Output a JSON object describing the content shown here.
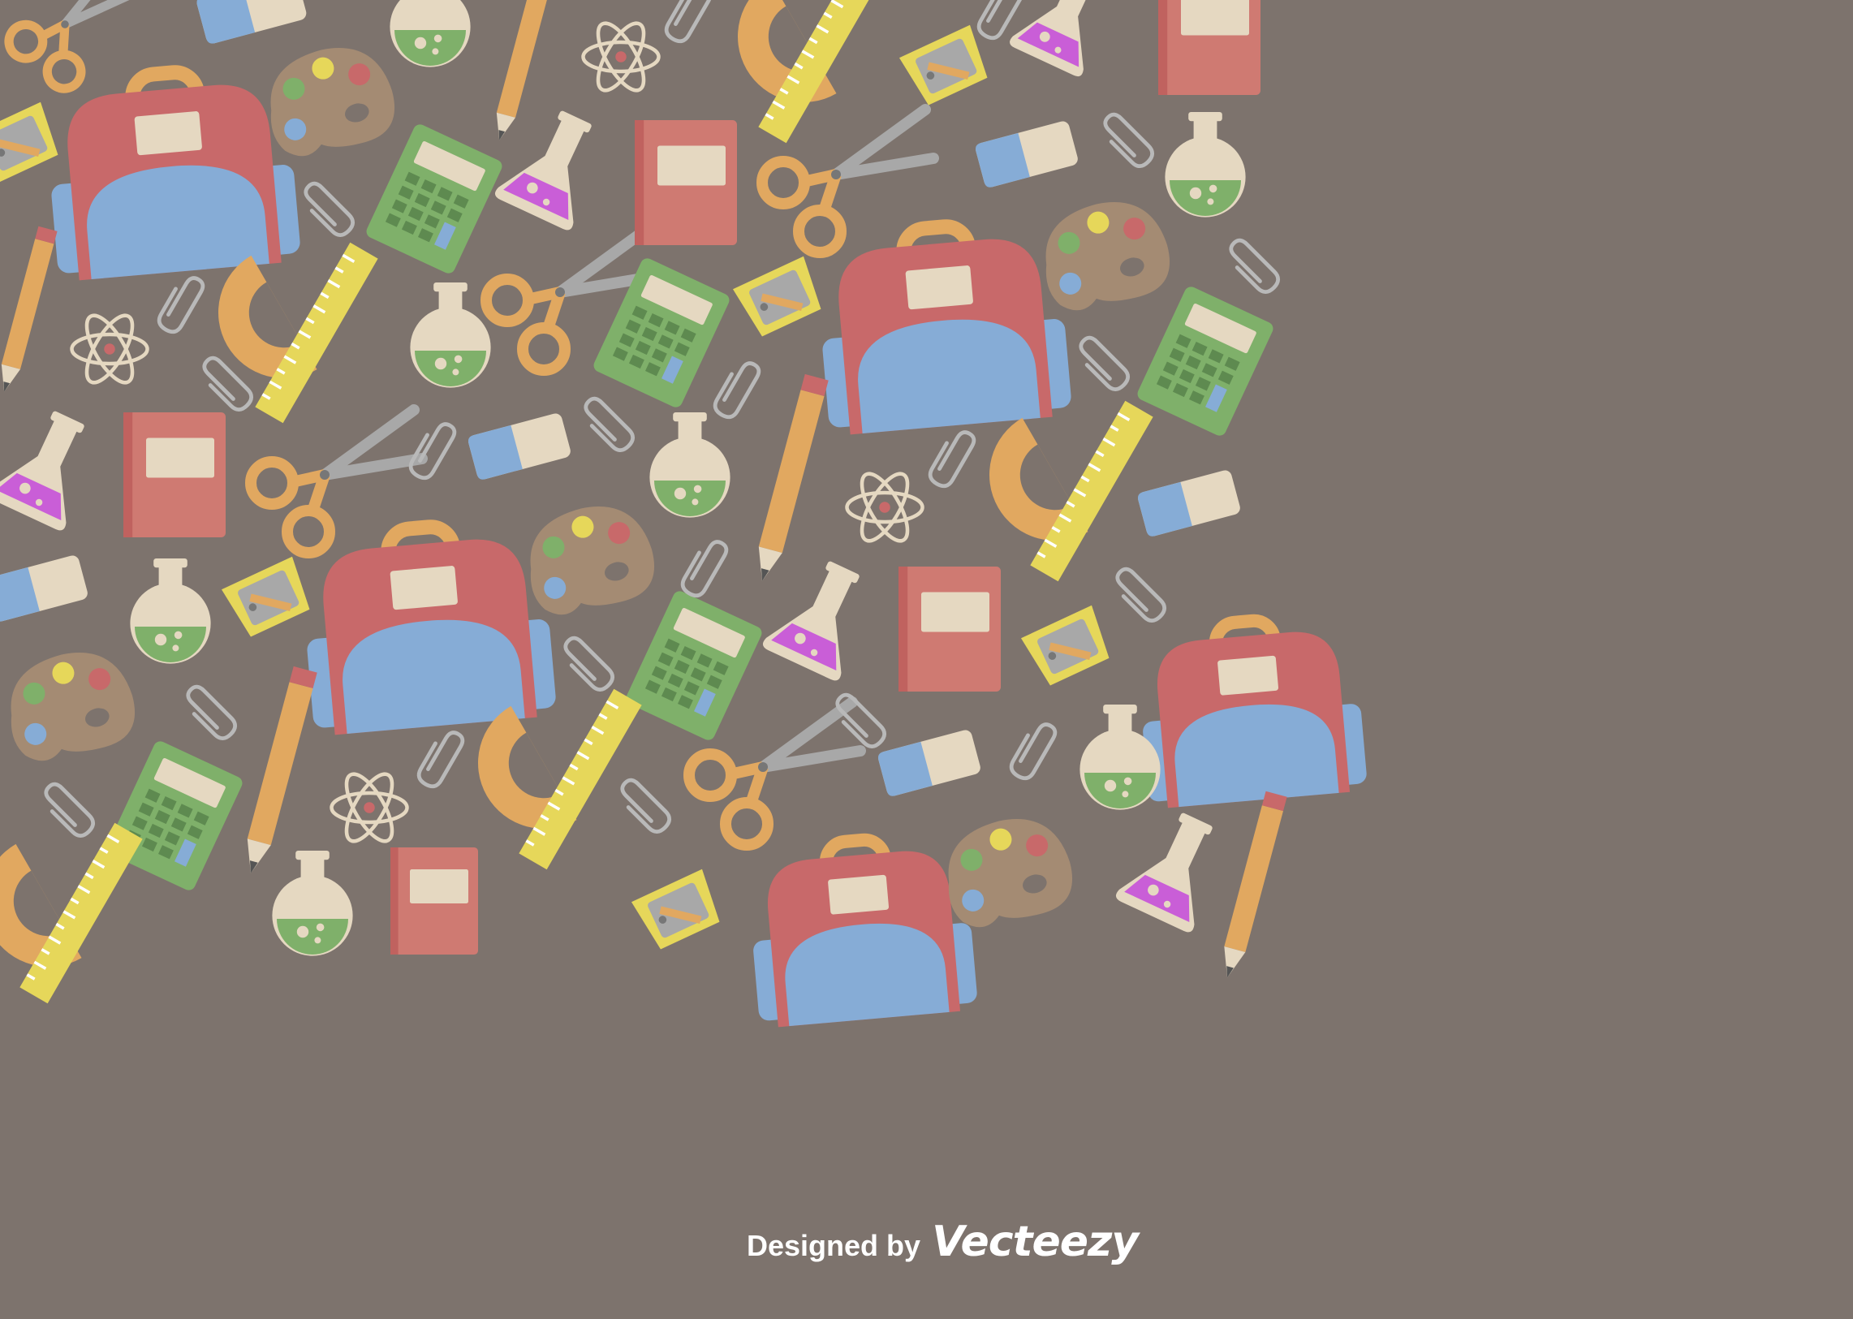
{
  "background_color": "#7d736d",
  "credit": {
    "designed_by": "Designed by",
    "brand": "Vecteezy"
  },
  "palette": {
    "red": "#c8696a",
    "blue": "#86acd6",
    "cream": "#e5d8c1",
    "orange": "#e1a860",
    "yellow": "#e6d75a",
    "green": "#7fb06a",
    "gray": "#a8a8a8",
    "purple": "#c95ed7"
  },
  "icons": [
    "backpack-icon",
    "paint-palette-icon",
    "scissors-icon",
    "pencil-icon",
    "calculator-icon",
    "flask-icon",
    "round-flask-icon",
    "notebook-icon",
    "eraser-icon",
    "paperclip-icon",
    "atom-icon",
    "protractor-icon",
    "ruler-icon",
    "sharpener-icon"
  ]
}
